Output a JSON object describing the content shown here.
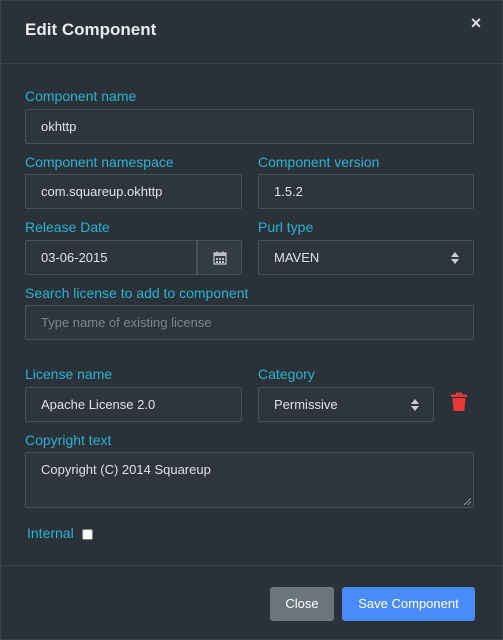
{
  "modal": {
    "title": "Edit Component",
    "close_icon": "×"
  },
  "fields": {
    "component_name": {
      "label": "Component name",
      "value": "okhttp"
    },
    "component_namespace": {
      "label": "Component namespace",
      "value": "com.squareup.okhttp"
    },
    "component_version": {
      "label": "Component version",
      "value": "1.5.2"
    },
    "release_date": {
      "label": "Release Date",
      "value": "03-06-2015",
      "icon": "calendar-icon"
    },
    "purl_type": {
      "label": "Purl type",
      "value": "MAVEN"
    },
    "search_license": {
      "label": "Search license to add to component",
      "placeholder": "Type name of existing license",
      "value": ""
    },
    "license_name": {
      "label": "License name",
      "value": "Apache License 2.0"
    },
    "category": {
      "label": "Category",
      "value": "Permissive"
    },
    "copyright": {
      "label": "Copyright text",
      "value": "Copyright  (C) 2014 Squareup"
    },
    "internal": {
      "label": "Internal",
      "checked": false
    }
  },
  "footer": {
    "close_label": "Close",
    "save_label": "Save Component"
  },
  "colors": {
    "accent_label": "#27b4d0",
    "primary_button": "#4a8cf7",
    "secondary_button": "#6c757d",
    "delete_icon": "#e53935"
  }
}
